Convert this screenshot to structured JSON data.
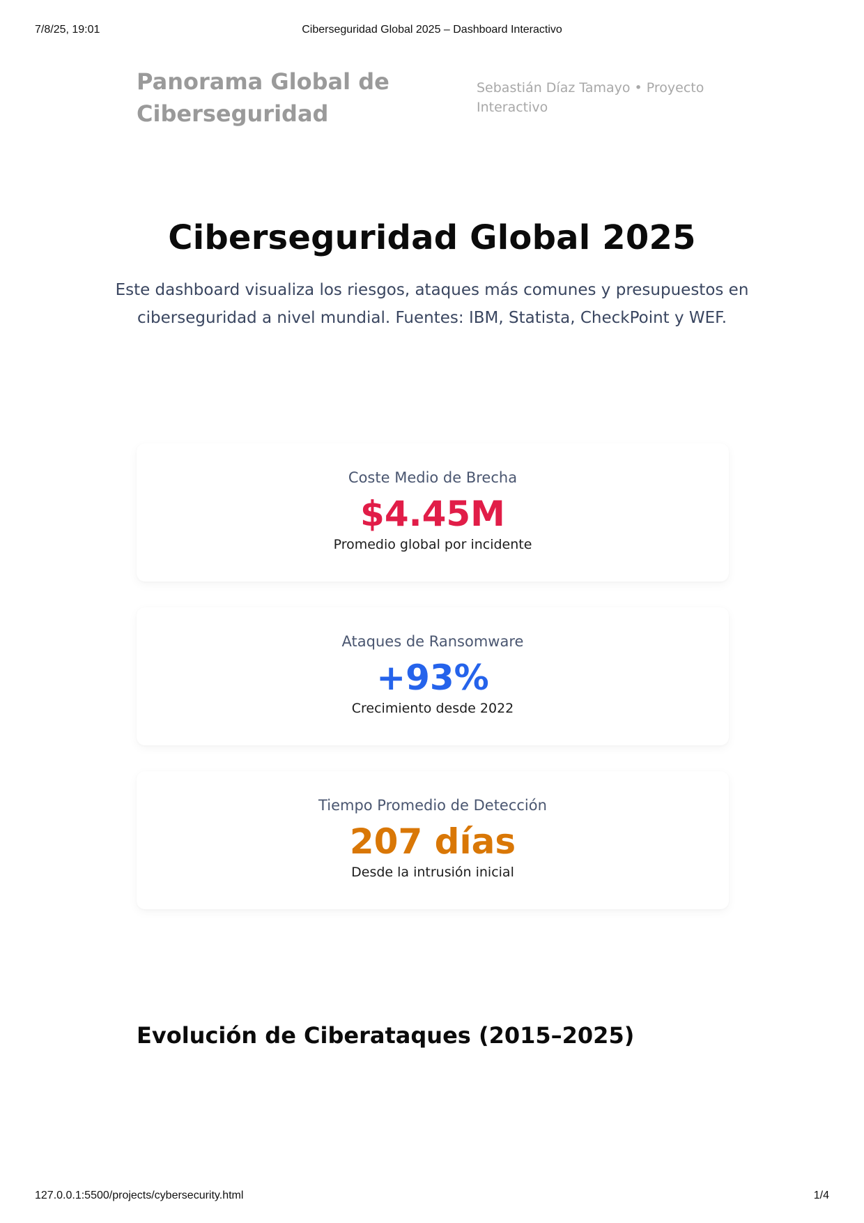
{
  "print": {
    "datetime": "7/8/25, 19:01",
    "doc_title": "Ciberseguridad Global 2025 – Dashboard Interactivo",
    "url": "127.0.0.1:5500/projects/cybersecurity.html",
    "page": "1/4"
  },
  "nav": {
    "brand": "Panorama Global de Ciberseguridad",
    "author": "Sebastián Díaz Tamayo • Proyecto Interactivo"
  },
  "hero": {
    "title": "Ciberseguridad Global 2025",
    "description": "Este dashboard visualiza los riesgos, ataques más comunes y presupuestos en ciberseguridad a nivel mundial. Fuentes: IBM, Statista, CheckPoint y WEF."
  },
  "metrics": [
    {
      "label": "Coste Medio de Brecha",
      "value": "$4.45M",
      "sub": "Promedio global por incidente",
      "color": "#e11d48"
    },
    {
      "label": "Ataques de Ransomware",
      "value": "+93%",
      "sub": "Crecimiento desde 2022",
      "color": "#2563eb"
    },
    {
      "label": "Tiempo Promedio de Detección",
      "value": "207 días",
      "sub": "Desde la intrusión inicial",
      "color": "#d97706"
    }
  ],
  "sections": {
    "evolution_title": "Evolución de Ciberataques (2015–2025)"
  }
}
